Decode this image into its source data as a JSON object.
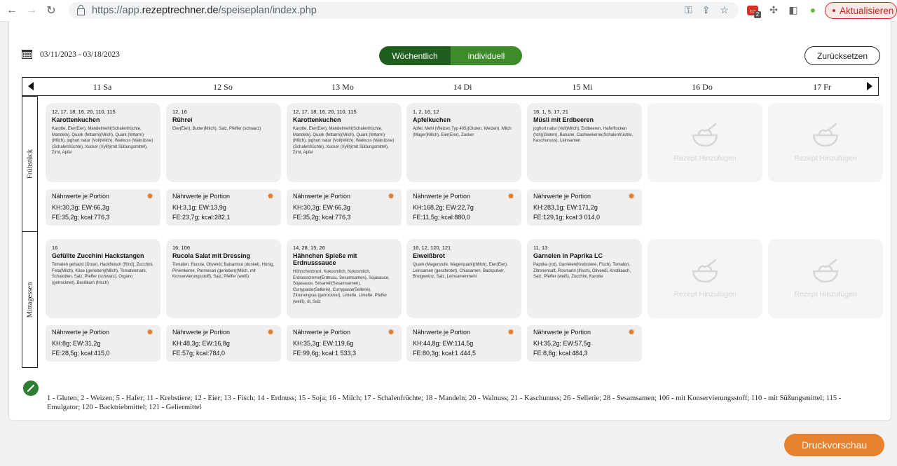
{
  "browser": {
    "url_prefix": "https://app.",
    "url_host": "rezeptrechner.de",
    "url_path": "/speiseplan/index.php",
    "update_label": "Aktualisieren",
    "ext_badge": "2"
  },
  "toolbar": {
    "date_range": "03/11/2023  - 03/18/2023",
    "toggle_weekly": "Wöchentlich",
    "toggle_individual": "individuell",
    "reset_label": "Zurücksetzen"
  },
  "days": [
    "11 Sa",
    "12 So",
    "13 Mo",
    "14 Di",
    "15 Mi",
    "16 Do",
    "17 Fr"
  ],
  "rows": [
    {
      "label": "Frühstück",
      "recipes": [
        {
          "allergens": "12, 17, 18, 16, 20, 110, 115",
          "title": "Karottenkuchen",
          "ingredients": "Karotte, Eier(Eier), Mandelmehl(Schalenfrüchte, Mandeln), Quark (fettarm)(Milch), Quark (fettarm)(Milch), joghurt natur (Voll)Milch), Walnuss (Walnüsse) (Schalenfrüchte), Xucker (Xylit)(mit Süßungsmittel), Zimt, Apfel",
          "n_title": "Nährwerte je Portion",
          "n_line1": "KH:30,3g; EW:66,3g",
          "n_line2": "FE:35,2g; kcal:776,3"
        },
        {
          "allergens": "12, 16",
          "title": "Rührei",
          "ingredients": "Eier(Eier), Butter(Milch), Salz, Pfeffer (schwarz)",
          "n_title": "Nährwerte je Portion",
          "n_line1": "KH:3,1g; EW:13,9g",
          "n_line2": "FE:23,7g; kcal:282,1"
        },
        {
          "allergens": "12, 17, 18, 16, 20, 110, 115",
          "title": "Karottenkuchen",
          "ingredients": "Karotte, Eier(Eier), Mandelmehl(Schalenfrüchte, Mandeln), Quark (fettarm)(Milch), Quark (fettarm)(Milch), joghurt natur (Voll)Milch), Walnuss (Walnüsse) (Schalenfrüchte), Xucker (Xylit)(mit Süßungsmittel), Zimt, Apfel",
          "n_title": "Nährwerte je Portion",
          "n_line1": "KH:30,3g; EW:66,3g",
          "n_line2": "FE:35,2g; kcal:776,3"
        },
        {
          "allergens": "1, 2, 16, 12",
          "title": "Apfelkuchen",
          "ingredients": "Apfel, Mehl (Weizen Typ 405)(Gluten, Weizen), Milch (Mager)Milch), Eier(Eier), Zucker",
          "n_title": "Nährwerte je Portion",
          "n_line1": "KH:168,2g; EW:22,7g",
          "n_line2": "FE:11,5g; kcal:880,0"
        },
        {
          "allergens": "16, 1, 5, 17, 21",
          "title": "Müsli mit Erdbeeren",
          "ingredients": "joghurt natur (Voll)Milch), Erdbeeren, Haferflocken (roh)(Gluten), Banane, Cashewkerne(Schalenfrüchte, Kaschunuss), Leinsamen",
          "n_title": "Nährwerte je Portion",
          "n_line1": "KH:283,1g; EW:171,2g",
          "n_line2": "FE:129,1g; kcal:3 014,0"
        }
      ]
    },
    {
      "label": "Mittagessen",
      "recipes": [
        {
          "allergens": "16",
          "title": "Gefüllte Zucchini Hackstangen",
          "ingredients": "Tomaten gehackt (Dose), Hackfleisch (Rind), Zucchini, Feta(Milch), Käse (gerieben)(Milch), Tomatenmark, Schalotten, Salz, Pfeffer (schwarz), Organo (getrocknet), Basilikum (frisch)",
          "n_title": "Nährwerte je Portion",
          "n_line1": "KH:8g; EW:31,2g",
          "n_line2": "FE:28,5g; kcal:415,0"
        },
        {
          "allergens": "16, 106",
          "title": "Rucola Salat mit Dressing",
          "ingredients": "Tomaten, Rucola, Olivenöl, Balsamico (dunkel), Honig, Pinienkerne, Parmesan (gerieben)(Milch, mit Konservierungsstoff), Salz, Pfeffer (weiß)",
          "n_title": "Nährwerte je Portion",
          "n_line1": "KH:48,3g; EW:16,8g",
          "n_line2": "FE:57g; kcal:784,0"
        },
        {
          "allergens": "14, 28, 15, 26",
          "title": "Hähnchen Spieße mit Erdnusssauce",
          "ingredients": "Hühnchenbrust, Kokosmilch, Kokosmilch, Erdnusscreme(Erdnuss, Sesamsamen), Sojasauce, Sojasauce, Sesamöl(Sesamsamen), Currypaste(Sellerie), Currypaste(Sellerie), Zitronengras (getrocknet), Limette, Limette, Pfeffer (weiß), öl, Salz",
          "n_title": "Nährwerte je Portion",
          "n_line1": "KH:35,3g; EW:119,6g",
          "n_line2": "FE:99,6g; kcal:1 533,3"
        },
        {
          "allergens": "16, 12, 120, 121",
          "title": "Eiweißbrot",
          "ingredients": "Quark (Magerstufe, Magerquark)(Milch), Eier(Eier), Leinsamen (geschrotet), Chiasamen, Backpulver, Brotgewürz, Salz, Leinsamenmehl",
          "n_title": "Nährwerte je Portion",
          "n_line1": "KH:44,8g; EW:114,5g",
          "n_line2": "FE:80,3g; kcal:1 444,5"
        },
        {
          "allergens": "11, 13",
          "title": "Garnelen in Paprika LC",
          "ingredients": "Paprika (rot), Garnelen(Krebstiere, Fisch), Tomaten, Zitronensaft, Rosmarin (frisch), Olivenöl, Knoblauch, Salz, Pfeffer (weiß), Zucchini, Karotte",
          "n_title": "Nährwerte je Portion",
          "n_line1": "KH:35,2g; EW:57,5g",
          "n_line2": "FE:8,8g; kcal:484,3"
        }
      ]
    }
  ],
  "empty_label": "Rezept Hinzufügen",
  "legend": "1 - Gluten; 2 - Weizen; 5 - Hafer; 11 - Krebstiere; 12 - Eier; 13 - Fisch; 14 - Erdnuss; 15 - Soja; 16 - Milch; 17 - Schalenfrüchte; 18 - Mandeln; 20 - Walnuss; 21 - Kaschunuss; 26 - Sellerie; 28 - Sesamsamen; 106 - mit Konservierungsstoff; 110 - mit Süßungsmittel; 115 - Emulgator; 120 - Backtriebmittel; 121 - Geliermittel",
  "print_label": "Druckvorschau",
  "colors": {
    "accent_green": "#1f5e1f",
    "green": "#3e8b2a",
    "orange": "#e8812e"
  }
}
